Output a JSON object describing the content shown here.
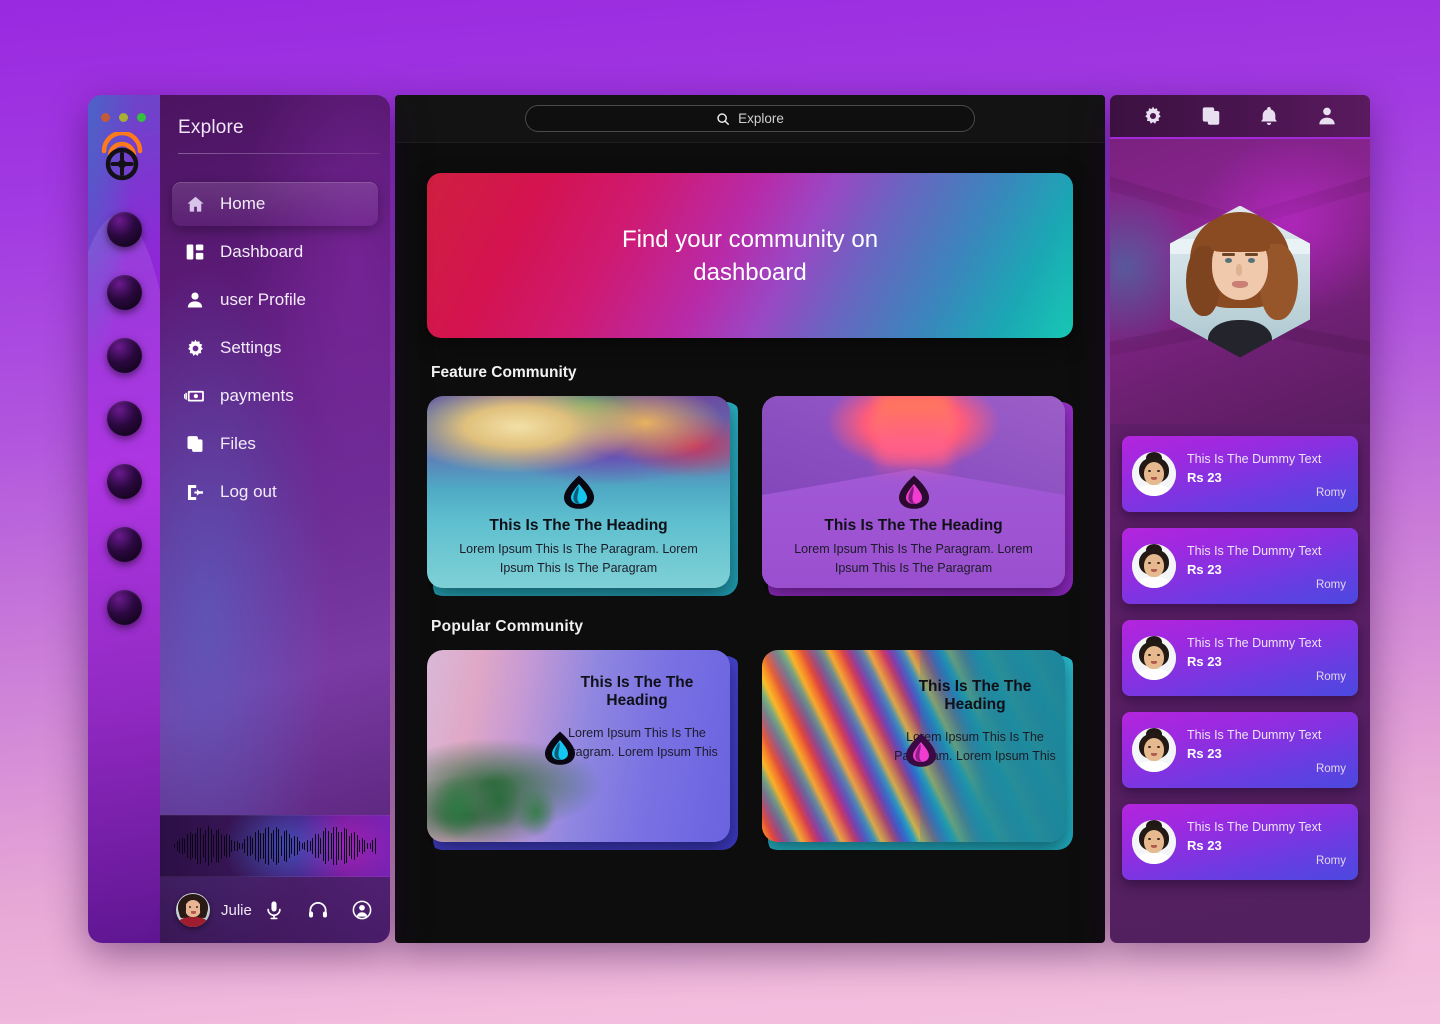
{
  "window": {
    "traffic_lights": [
      "close",
      "minimize",
      "maximize"
    ],
    "logo_name": "wheel-wifi-logo"
  },
  "sidebar": {
    "title": "Explore",
    "items": [
      {
        "label": "Home",
        "icon": "home-icon",
        "active": true
      },
      {
        "label": "Dashboard",
        "icon": "dashboard-icon",
        "active": false
      },
      {
        "label": "user Profile",
        "icon": "user-icon",
        "active": false
      },
      {
        "label": "Settings",
        "icon": "gear-icon",
        "active": false
      },
      {
        "label": "payments",
        "icon": "payments-icon",
        "active": false
      },
      {
        "label": "Files",
        "icon": "files-icon",
        "active": false
      },
      {
        "label": "Log out",
        "icon": "logout-icon",
        "active": false
      }
    ],
    "rail_dot_count": 7,
    "footer": {
      "user_name": "Julie",
      "icons": [
        "microphone-icon",
        "headphones-icon",
        "account-icon"
      ]
    },
    "waveform_label": "audio-waveform"
  },
  "search": {
    "placeholder": "Explore",
    "value": "Explore",
    "icon": "search-icon"
  },
  "hero": {
    "line1": "Find your community on",
    "line2": "dashboard",
    "gradient_from": "#cf2040",
    "gradient_mid": "#9a47c4",
    "gradient_to": "#18c8b4"
  },
  "sections": [
    {
      "title": "Feature Community",
      "cards": [
        {
          "heading": "This Is The The Heading",
          "description": "Lorem Ipsum This Is The Paragram. Lorem Ipsum This Is The Paragram",
          "art": "clouds-over-water",
          "badge_icon": "community-badge-cyan"
        },
        {
          "heading": "This Is The The Heading",
          "description": "Lorem Ipsum This Is The Paragram. Lorem Ipsum This Is The Paragram",
          "art": "neon-corridor",
          "badge_icon": "community-badge-magenta"
        }
      ]
    },
    {
      "title": "Popular  Community",
      "cards": [
        {
          "heading": "This Is The The Heading",
          "description": "Lorem Ipsum This Is The Paragram. Lorem Ipsum This",
          "art": "palm-trees-sunset",
          "badge_icon": "community-badge-cyan"
        },
        {
          "heading": "This Is The The Heading",
          "description": "Lorem Ipsum This Is The Paragram. Lorem Ipsum This",
          "art": "soap-bubble-swirl",
          "badge_icon": "community-badge-magenta"
        }
      ]
    }
  ],
  "right_panel": {
    "toolbar_icons": [
      "gear-icon",
      "copy-icon",
      "bell-icon",
      "person-icon"
    ],
    "profile_photo_alt": "profile-hexagon-photo",
    "list": [
      {
        "title": "This Is The Dummy Text",
        "price": "Rs 23",
        "user": "Romy"
      },
      {
        "title": "This Is The Dummy Text",
        "price": "Rs 23",
        "user": "Romy"
      },
      {
        "title": "This Is The Dummy Text",
        "price": "Rs 23",
        "user": "Romy"
      },
      {
        "title": "This Is The Dummy Text",
        "price": "Rs 23",
        "user": "Romy"
      },
      {
        "title": "This Is The Dummy Text",
        "price": "Rs 23",
        "user": "Romy"
      }
    ]
  },
  "colors": {
    "page_bg_top": "#9a29e0",
    "page_bg_bottom": "#f4c2e0",
    "accent_purple": "#a32ad8",
    "center_bg": "#0d0d0d"
  }
}
